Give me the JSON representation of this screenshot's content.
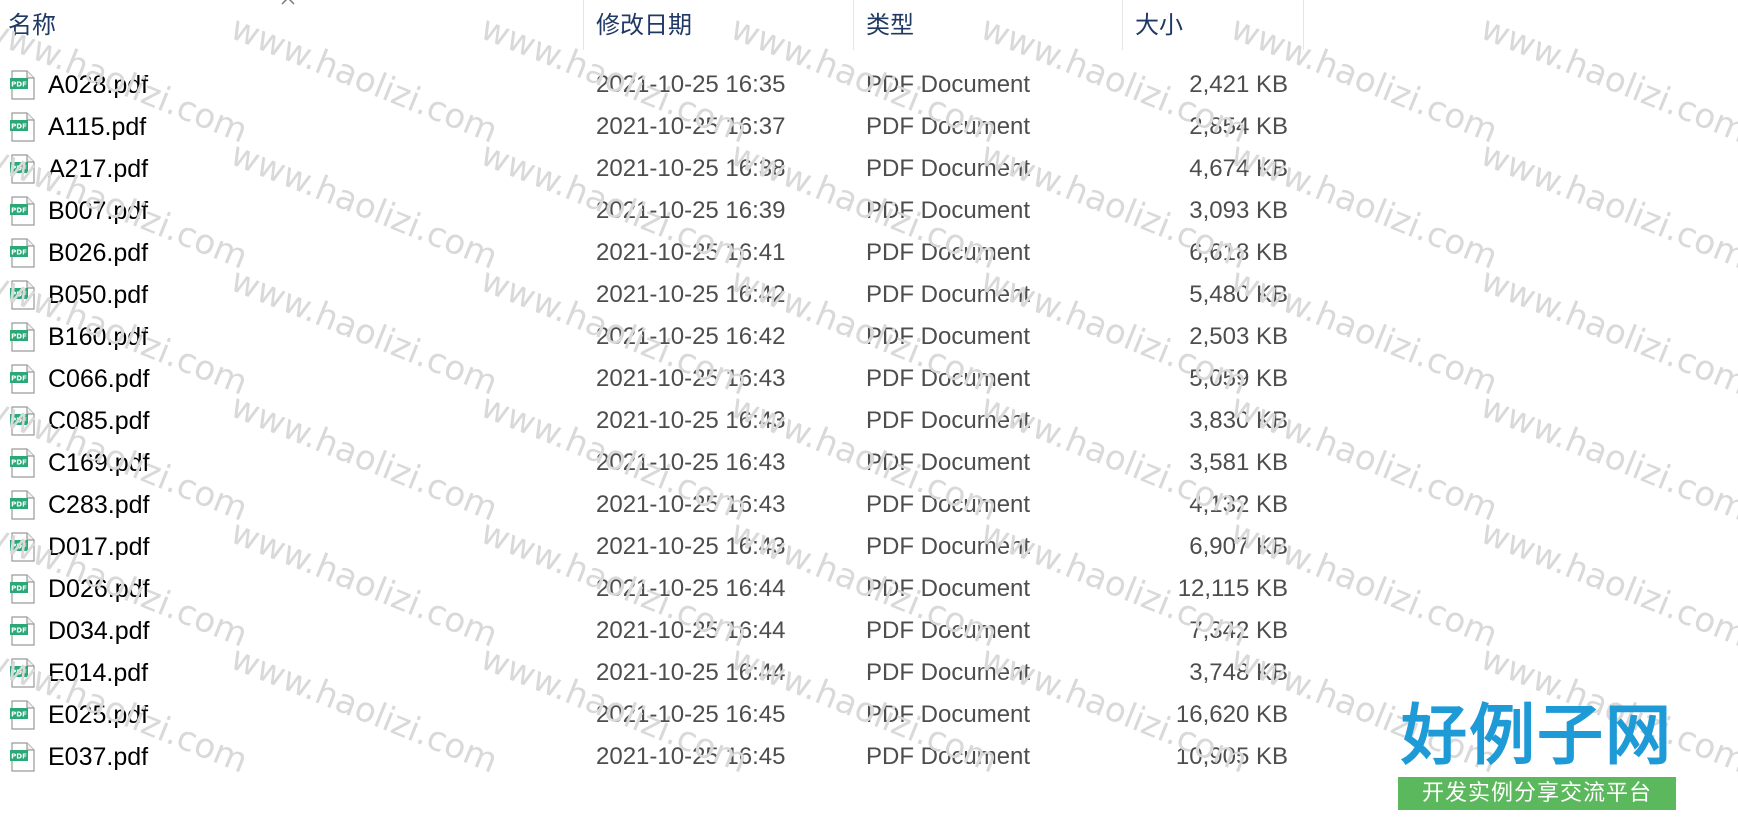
{
  "columns": {
    "name": "名称",
    "modified": "修改日期",
    "type": "类型",
    "size": "大小"
  },
  "files": [
    {
      "name": "A028.pdf",
      "modified": "2021-10-25 16:35",
      "type": "PDF Document",
      "size": "2,421 KB"
    },
    {
      "name": "A115.pdf",
      "modified": "2021-10-25 16:37",
      "type": "PDF Document",
      "size": "2,854 KB"
    },
    {
      "name": "A217.pdf",
      "modified": "2021-10-25 16:38",
      "type": "PDF Document",
      "size": "4,674 KB"
    },
    {
      "name": "B007.pdf",
      "modified": "2021-10-25 16:39",
      "type": "PDF Document",
      "size": "3,093 KB"
    },
    {
      "name": "B026.pdf",
      "modified": "2021-10-25 16:41",
      "type": "PDF Document",
      "size": "6,618 KB"
    },
    {
      "name": "B050.pdf",
      "modified": "2021-10-25 16:42",
      "type": "PDF Document",
      "size": "5,480 KB"
    },
    {
      "name": "B160.pdf",
      "modified": "2021-10-25 16:42",
      "type": "PDF Document",
      "size": "2,503 KB"
    },
    {
      "name": "C066.pdf",
      "modified": "2021-10-25 16:43",
      "type": "PDF Document",
      "size": "5,059 KB"
    },
    {
      "name": "C085.pdf",
      "modified": "2021-10-25 16:43",
      "type": "PDF Document",
      "size": "3,830 KB"
    },
    {
      "name": "C169.pdf",
      "modified": "2021-10-25 16:43",
      "type": "PDF Document",
      "size": "3,581 KB"
    },
    {
      "name": "C283.pdf",
      "modified": "2021-10-25 16:43",
      "type": "PDF Document",
      "size": "4,132 KB"
    },
    {
      "name": "D017.pdf",
      "modified": "2021-10-25 16:43",
      "type": "PDF Document",
      "size": "6,907 KB"
    },
    {
      "name": "D026.pdf",
      "modified": "2021-10-25 16:44",
      "type": "PDF Document",
      "size": "12,115 KB"
    },
    {
      "name": "D034.pdf",
      "modified": "2021-10-25 16:44",
      "type": "PDF Document",
      "size": "7,342 KB"
    },
    {
      "name": "E014.pdf",
      "modified": "2021-10-25 16:44",
      "type": "PDF Document",
      "size": "3,748 KB"
    },
    {
      "name": "E025.pdf",
      "modified": "2021-10-25 16:45",
      "type": "PDF Document",
      "size": "16,620 KB"
    },
    {
      "name": "E037.pdf",
      "modified": "2021-10-25 16:45",
      "type": "PDF Document",
      "size": "10,905 KB"
    }
  ],
  "file_icon": {
    "name": "pdf-file-icon",
    "label": "PDF",
    "color": "#2aa876"
  },
  "watermark": {
    "text": "www.haolizi.com",
    "color": "#d9d9d9"
  },
  "logo": {
    "title": "好例子网",
    "subtitle": "开发实例分享交流平台",
    "title_color": "#1e9ad6",
    "subtitle_bg": "#5cb85c"
  },
  "sort_indicator": {
    "name": "chevron-up-icon"
  }
}
